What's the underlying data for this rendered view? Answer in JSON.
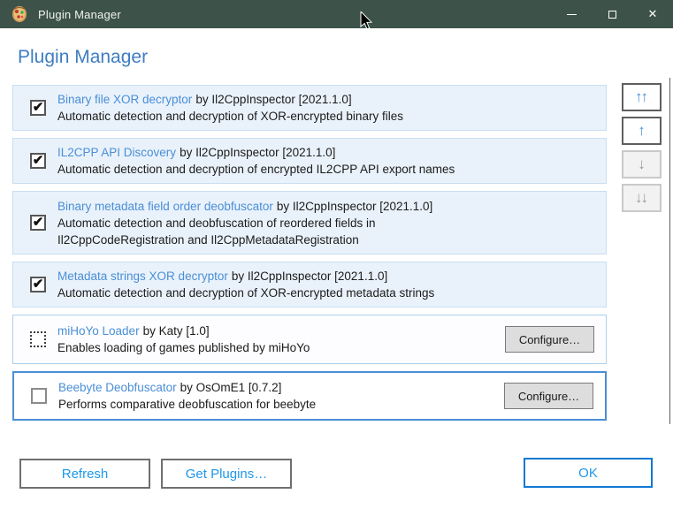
{
  "window": {
    "title": "Plugin Manager",
    "controls": {
      "minimize": "minimize",
      "maximize": "maximize",
      "close": "✕"
    }
  },
  "header": {
    "title": "Plugin Manager"
  },
  "labels": {
    "configure": "Configure…"
  },
  "icons": {
    "check": "✔",
    "app_logo": "beetle-logo"
  },
  "plugins": [
    {
      "name": "Binary file XOR decryptor",
      "byline": "by Il2CppInspector [2021.1.0]",
      "description": "Automatic detection and decryption of XOR-encrypted binary files",
      "checkbox_state": "checked",
      "has_configure": false,
      "highlighted": true
    },
    {
      "name": "IL2CPP API Discovery",
      "byline": "by Il2CppInspector [2021.1.0]",
      "description": "Automatic detection and decryption of encrypted IL2CPP API export names",
      "checkbox_state": "checked",
      "has_configure": false,
      "highlighted": true
    },
    {
      "name": "Binary metadata field order deobfuscator",
      "byline": "by Il2CppInspector [2021.1.0]",
      "description": "Automatic detection and deobfuscation of reordered fields in Il2CppCodeRegistration and Il2CppMetadataRegistration",
      "checkbox_state": "checked",
      "has_configure": false,
      "highlighted": true
    },
    {
      "name": "Metadata strings XOR decryptor",
      "byline": "by Il2CppInspector [2021.1.0]",
      "description": "Automatic detection and decryption of XOR-encrypted metadata strings",
      "checkbox_state": "checked",
      "has_configure": false,
      "highlighted": true
    },
    {
      "name": "miHoYo Loader",
      "byline": "by Katy [1.0]",
      "description": "Enables loading of games published by miHoYo",
      "checkbox_state": "indeterminate",
      "has_configure": true,
      "highlighted": false
    },
    {
      "name": "Beebyte Deobfuscator",
      "byline": "by OsOmE1 [0.7.2]",
      "description": "Performs comparative deobfuscation for beebyte",
      "checkbox_state": "unchecked",
      "has_configure": true,
      "highlighted": false,
      "selected": true
    }
  ],
  "reorder_buttons": [
    {
      "name": "move-to-top",
      "glyph": "↑↑",
      "enabled": true
    },
    {
      "name": "move-up",
      "glyph": "↑",
      "enabled": true
    },
    {
      "name": "move-down",
      "glyph": "↓",
      "enabled": false
    },
    {
      "name": "move-to-bottom",
      "glyph": "↓↓",
      "enabled": false
    }
  ],
  "footer": {
    "refresh": "Refresh",
    "get_plugins": "Get Plugins…",
    "ok": "OK"
  },
  "colors": {
    "titlebar": "#3d5349",
    "heading_blue": "#3e7dc1",
    "link_blue": "#4a8ed6",
    "row_highlight": "#e9f2fb",
    "selected_border": "#4a8fd5",
    "button_text_blue": "#1e97ea",
    "ok_border_blue": "#1178d2"
  }
}
